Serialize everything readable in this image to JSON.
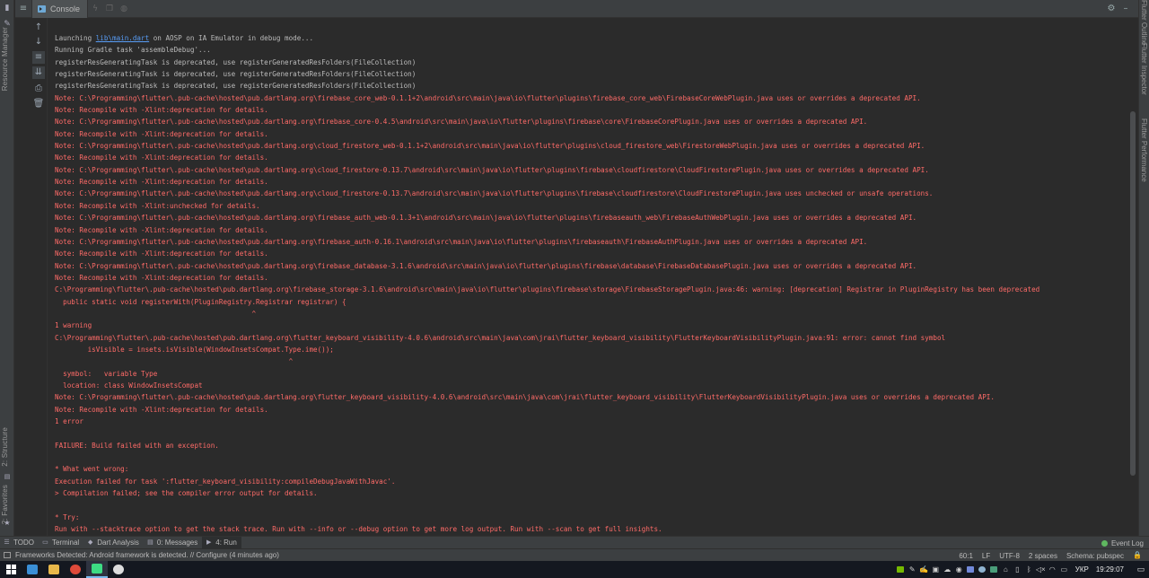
{
  "left_strip": {
    "tabs": [
      "Resource Manager",
      "2: Structure",
      "2: Favorites"
    ]
  },
  "right_strip": {
    "tabs": [
      "Flutter Outline",
      "Flutter Inspector",
      "Flutter Performance"
    ]
  },
  "tool_window": {
    "tab_label": "Console"
  },
  "console": {
    "lines": [
      {
        "t": "Launching ",
        "link": "lib\\main.dart",
        "rest": " on AOSP on IA Emulator in debug mode...",
        "err": false
      },
      {
        "t": "Running Gradle task 'assembleDebug'...",
        "err": false
      },
      {
        "t": "registerResGeneratingTask is deprecated, use registerGeneratedResFolders(FileCollection)",
        "err": false
      },
      {
        "t": "registerResGeneratingTask is deprecated, use registerGeneratedResFolders(FileCollection)",
        "err": false
      },
      {
        "t": "registerResGeneratingTask is deprecated, use registerGeneratedResFolders(FileCollection)",
        "err": false
      },
      {
        "t": "Note: C:\\Programming\\flutter\\.pub-cache\\hosted\\pub.dartlang.org\\firebase_core_web-0.1.1+2\\android\\src\\main\\java\\io\\flutter\\plugins\\firebase_core_web\\FirebaseCoreWebPlugin.java uses or overrides a deprecated API.",
        "err": true
      },
      {
        "t": "Note: Recompile with -Xlint:deprecation for details.",
        "err": true
      },
      {
        "t": "Note: C:\\Programming\\flutter\\.pub-cache\\hosted\\pub.dartlang.org\\firebase_core-0.4.5\\android\\src\\main\\java\\io\\flutter\\plugins\\firebase\\core\\FirebaseCorePlugin.java uses or overrides a deprecated API.",
        "err": true
      },
      {
        "t": "Note: Recompile with -Xlint:deprecation for details.",
        "err": true
      },
      {
        "t": "Note: C:\\Programming\\flutter\\.pub-cache\\hosted\\pub.dartlang.org\\cloud_firestore_web-0.1.1+2\\android\\src\\main\\java\\io\\flutter\\plugins\\cloud_firestore_web\\FirestoreWebPlugin.java uses or overrides a deprecated API.",
        "err": true
      },
      {
        "t": "Note: Recompile with -Xlint:deprecation for details.",
        "err": true
      },
      {
        "t": "Note: C:\\Programming\\flutter\\.pub-cache\\hosted\\pub.dartlang.org\\cloud_firestore-0.13.7\\android\\src\\main\\java\\io\\flutter\\plugins\\firebase\\cloudfirestore\\CloudFirestorePlugin.java uses or overrides a deprecated API.",
        "err": true
      },
      {
        "t": "Note: Recompile with -Xlint:deprecation for details.",
        "err": true
      },
      {
        "t": "Note: C:\\Programming\\flutter\\.pub-cache\\hosted\\pub.dartlang.org\\cloud_firestore-0.13.7\\android\\src\\main\\java\\io\\flutter\\plugins\\firebase\\cloudfirestore\\CloudFirestorePlugin.java uses unchecked or unsafe operations.",
        "err": true
      },
      {
        "t": "Note: Recompile with -Xlint:unchecked for details.",
        "err": true
      },
      {
        "t": "Note: C:\\Programming\\flutter\\.pub-cache\\hosted\\pub.dartlang.org\\firebase_auth_web-0.1.3+1\\android\\src\\main\\java\\io\\flutter\\plugins\\firebaseauth_web\\FirebaseAuthWebPlugin.java uses or overrides a deprecated API.",
        "err": true
      },
      {
        "t": "Note: Recompile with -Xlint:deprecation for details.",
        "err": true
      },
      {
        "t": "Note: C:\\Programming\\flutter\\.pub-cache\\hosted\\pub.dartlang.org\\firebase_auth-0.16.1\\android\\src\\main\\java\\io\\flutter\\plugins\\firebaseauth\\FirebaseAuthPlugin.java uses or overrides a deprecated API.",
        "err": true
      },
      {
        "t": "Note: Recompile with -Xlint:deprecation for details.",
        "err": true
      },
      {
        "t": "Note: C:\\Programming\\flutter\\.pub-cache\\hosted\\pub.dartlang.org\\firebase_database-3.1.6\\android\\src\\main\\java\\io\\flutter\\plugins\\firebase\\database\\FirebaseDatabasePlugin.java uses or overrides a deprecated API.",
        "err": true
      },
      {
        "t": "Note: Recompile with -Xlint:deprecation for details.",
        "err": true
      },
      {
        "t": "C:\\Programming\\flutter\\.pub-cache\\hosted\\pub.dartlang.org\\firebase_storage-3.1.6\\android\\src\\main\\java\\io\\flutter\\plugins\\firebase\\storage\\FirebaseStoragePlugin.java:46: warning: [deprecation] Registrar in PluginRegistry has been deprecated",
        "err": true
      },
      {
        "t": "  public static void registerWith(PluginRegistry.Registrar registrar) {",
        "err": true
      },
      {
        "t": "                                                ^",
        "err": true
      },
      {
        "t": "1 warning",
        "err": true
      },
      {
        "t": "C:\\Programming\\flutter\\.pub-cache\\hosted\\pub.dartlang.org\\flutter_keyboard_visibility-4.0.6\\android\\src\\main\\java\\com\\jrai\\flutter_keyboard_visibility\\FlutterKeyboardVisibilityPlugin.java:91: error: cannot find symbol",
        "err": true
      },
      {
        "t": "        isVisible = insets.isVisible(WindowInsetsCompat.Type.ime());",
        "err": true
      },
      {
        "t": "                                                         ^",
        "err": true
      },
      {
        "t": "  symbol:   variable Type",
        "err": true
      },
      {
        "t": "  location: class WindowInsetsCompat",
        "err": true
      },
      {
        "t": "Note: C:\\Programming\\flutter\\.pub-cache\\hosted\\pub.dartlang.org\\flutter_keyboard_visibility-4.0.6\\android\\src\\main\\java\\com\\jrai\\flutter_keyboard_visibility\\FlutterKeyboardVisibilityPlugin.java uses or overrides a deprecated API.",
        "err": true
      },
      {
        "t": "Note: Recompile with -Xlint:deprecation for details.",
        "err": true
      },
      {
        "t": "1 error",
        "err": true
      },
      {
        "t": "",
        "err": true
      },
      {
        "t": "FAILURE: Build failed with an exception.",
        "err": true
      },
      {
        "t": "",
        "err": true
      },
      {
        "t": "* What went wrong:",
        "err": true
      },
      {
        "t": "Execution failed for task ':flutter_keyboard_visibility:compileDebugJavaWithJavac'.",
        "err": true
      },
      {
        "t": "> Compilation failed; see the compiler error output for details.",
        "err": true
      },
      {
        "t": "",
        "err": true
      },
      {
        "t": "* Try:",
        "err": true
      },
      {
        "t": "Run with --stacktrace option to get the stack trace. Run with --info or --debug option to get more log output. Run with --scan to get full insights.",
        "err": true
      }
    ]
  },
  "bottom_tabs": [
    {
      "label": "TODO",
      "icon": "todo-icon",
      "active": false
    },
    {
      "label": "Terminal",
      "icon": "terminal-icon",
      "active": false
    },
    {
      "label": "Dart Analysis",
      "icon": "dart-icon",
      "active": false
    },
    {
      "label": "0: Messages",
      "icon": "messages-icon",
      "active": false
    },
    {
      "label": "4: Run",
      "icon": "run-icon",
      "active": true
    }
  ],
  "event_log": {
    "label": "Event Log",
    "status_color": "#5fb760"
  },
  "status_bar": {
    "message": "Frameworks Detected: Android framework is detected. // Configure (4 minutes ago)",
    "position": "60:1",
    "line_sep": "LF",
    "encoding": "UTF-8",
    "indent": "2 spaces",
    "schema": "Schema: pubspec"
  },
  "taskbar": {
    "language": "УКР",
    "time": "19:29:07"
  },
  "colors": {
    "error_text": "#ff6b68",
    "normal_text": "#bbbbbb",
    "link": "#589df6",
    "background": "#2b2b2b"
  }
}
